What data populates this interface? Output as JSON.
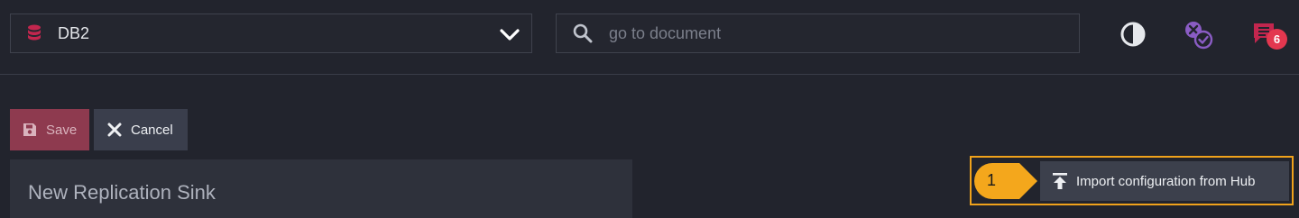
{
  "header": {
    "database": {
      "label": "DB2",
      "icon": "database-icon"
    },
    "search": {
      "placeholder": "go to document",
      "value": ""
    },
    "icons": [
      "theme-contrast-icon",
      "conflicts-icon",
      "notifications-icon"
    ],
    "notifications": {
      "count": "6"
    }
  },
  "toolbar": {
    "save_label": "Save",
    "cancel_label": "Cancel"
  },
  "panel": {
    "title": "New Replication Sink"
  },
  "callout": {
    "step": "1",
    "import_label": "Import configuration from Hub"
  },
  "colors": {
    "background": "#22242d",
    "accent_red": "#c2264e",
    "accent_purple": "#8a5cc4",
    "badge": "#e3374f",
    "highlight": "#f0a21b"
  }
}
